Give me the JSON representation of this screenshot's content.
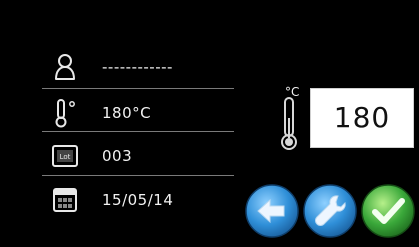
{
  "rows": [
    {
      "icon": "person-icon",
      "value": "------------"
    },
    {
      "icon": "temperature-icon",
      "value": "180°C"
    },
    {
      "icon": "lot-icon",
      "icon_text": "Lot",
      "value": "003"
    },
    {
      "icon": "calendar-icon",
      "value": "15/05/14"
    }
  ],
  "temperature": {
    "unit": "°C",
    "value": "180"
  },
  "buttons": [
    {
      "name": "back-button",
      "icon": "arrow-left-icon",
      "color": "#2f8fd8"
    },
    {
      "name": "settings-button",
      "icon": "wrench-icon",
      "color": "#2f8fd8"
    },
    {
      "name": "confirm-button",
      "icon": "check-icon",
      "color": "#3aa83a"
    }
  ],
  "colors": {
    "background": "#000000",
    "text": "#f2f2f2",
    "accent_blue": "#2f8fd8",
    "accent_green": "#3aa83a"
  }
}
